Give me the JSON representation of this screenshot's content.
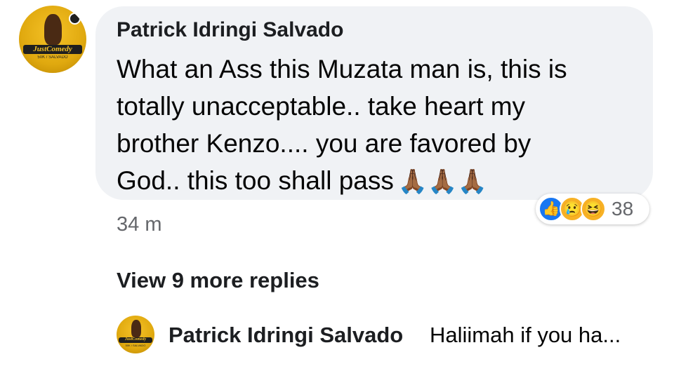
{
  "comment": {
    "author": "Patrick Idringi Salvado",
    "text": "What an Ass this Muzata man is, this is\ntotally unacceptable.. take heart my\nbrother Kenzo.... you are favored by\nGod.. this too shall pass",
    "emoji": "🙏🏾🙏🏾🙏🏾",
    "time": "34 m",
    "avatar": {
      "logo_text": "JustComedy",
      "subline": "50K / SALVADO"
    },
    "reactions": {
      "icons": [
        "like-icon",
        "sad-icon",
        "haha-icon"
      ],
      "count": "38"
    }
  },
  "replies": {
    "view_more_label": "View 9 more replies",
    "latest": {
      "author": "Patrick Idringi Salvado",
      "preview": "Haliimah if you ha...",
      "avatar": {
        "logo_text": "JustComedy",
        "subline": "50K / SALVADO"
      }
    }
  }
}
